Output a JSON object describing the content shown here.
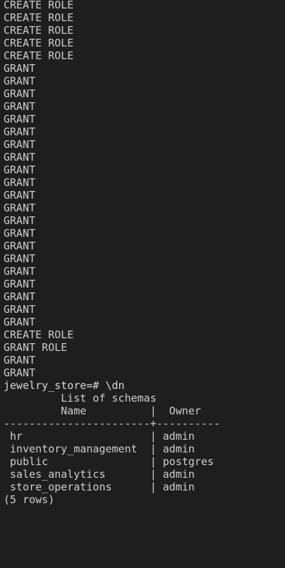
{
  "terminal": {
    "output_lines": [
      "CREATE ROLE",
      "CREATE ROLE",
      "CREATE ROLE",
      "CREATE ROLE",
      "CREATE ROLE",
      "GRANT",
      "GRANT",
      "GRANT",
      "GRANT",
      "GRANT",
      "GRANT",
      "GRANT",
      "GRANT",
      "GRANT",
      "GRANT",
      "GRANT",
      "GRANT",
      "GRANT",
      "GRANT",
      "GRANT",
      "GRANT",
      "GRANT",
      "GRANT",
      "GRANT",
      "GRANT",
      "GRANT",
      "CREATE ROLE",
      "GRANT ROLE",
      "GRANT",
      "GRANT"
    ],
    "prompt": "jewelry_store=# \\dn",
    "table": {
      "title_line": "         List of schemas",
      "header_line": "         Name          |  Owner",
      "separator_line": "-----------------------+----------",
      "rows": [
        " hr                    | admin",
        " inventory_management  | admin",
        " public                | postgres",
        " sales_analytics       | admin",
        " store_operations      | admin"
      ],
      "footer": "(5 rows)"
    }
  }
}
